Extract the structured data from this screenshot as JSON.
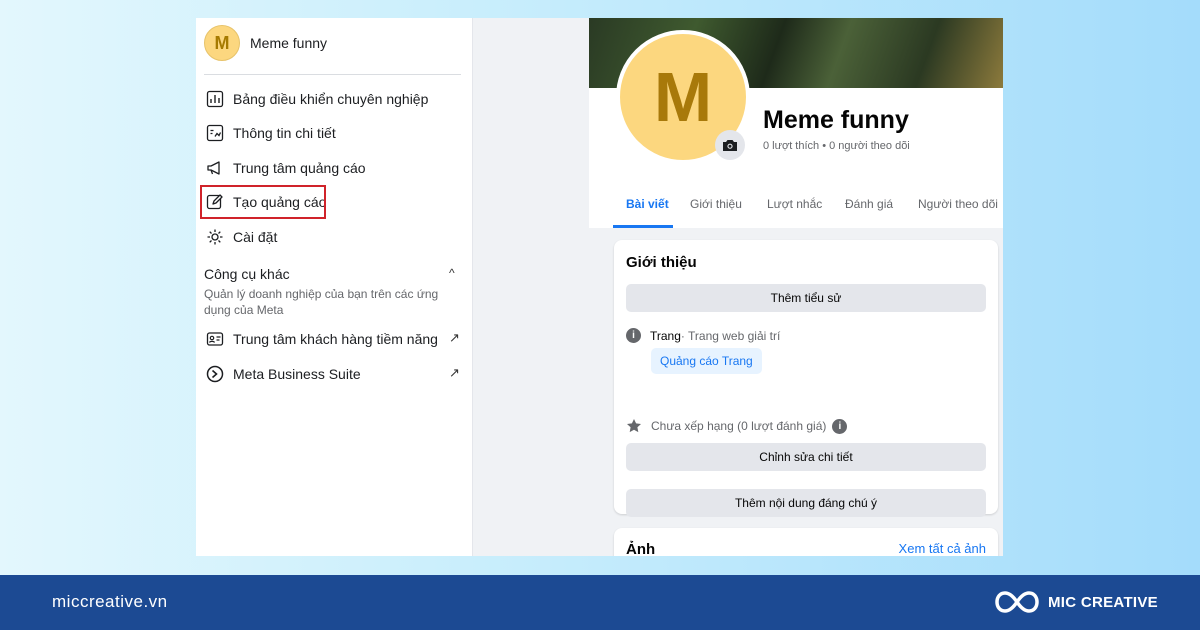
{
  "page": {
    "name": "Meme funny",
    "avatar_letter": "M",
    "stats": "0 lượt thích • 0 người theo dõi"
  },
  "sidebar": {
    "items": [
      {
        "label": "Bảng điều khiển chuyên nghiệp",
        "icon": "dashboard-icon"
      },
      {
        "label": "Thông tin chi tiết",
        "icon": "insights-icon"
      },
      {
        "label": "Trung tâm quảng cáo",
        "icon": "megaphone-icon"
      },
      {
        "label": "Tạo quảng cáo",
        "icon": "edit-icon",
        "highlighted": true
      },
      {
        "label": "Cài đặt",
        "icon": "gear-icon"
      }
    ],
    "section": {
      "title": "Công cụ khác",
      "subtitle": "Quản lý doanh nghiệp của bạn trên các ứng dụng của Meta",
      "caret": "^"
    },
    "tools": [
      {
        "label": "Trung tâm khách hàng tiềm năng",
        "icon": "contact-card-icon",
        "arrow": "↗"
      },
      {
        "label": "Meta Business Suite",
        "icon": "meta-business-icon",
        "arrow": "↗"
      }
    ]
  },
  "tabs": [
    "Bài viết",
    "Giới thiệu",
    "Lượt nhắc",
    "Đánh giá",
    "Người theo dõi"
  ],
  "intro": {
    "title": "Giới thiệu",
    "add_bio": "Thêm tiểu sử",
    "category_label": "Trang",
    "category_value": " · Trang web giải trí",
    "promote_page": "Quảng cáo Trang",
    "rating": "Chưa xếp hạng (0 lượt đánh giá)",
    "edit_details": "Chỉnh sửa chi tiết",
    "add_featured": "Thêm nội dung đáng chú ý"
  },
  "photos": {
    "title": "Ảnh",
    "see_all": "Xem tất cả ảnh"
  },
  "footer": {
    "url": "miccreative.vn",
    "brand": "MIC CREATIVE"
  },
  "colors": {
    "accent": "#1877f2",
    "highlight_border": "#d0232a",
    "footer_bg": "#1c4a93",
    "avatar_bg": "#fcd77f"
  }
}
